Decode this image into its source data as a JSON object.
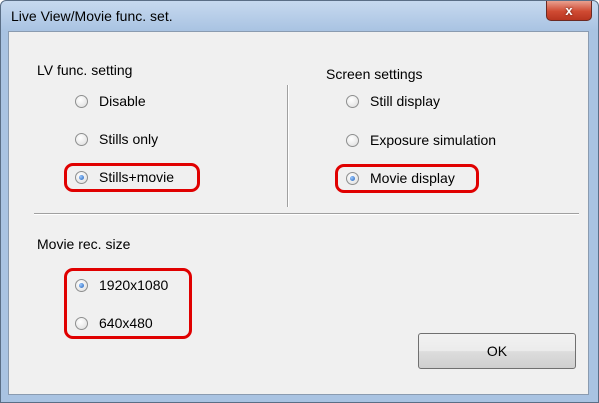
{
  "window": {
    "title": "Live View/Movie func. set.",
    "close_glyph": "x"
  },
  "lv_func": {
    "heading": "LV func. setting",
    "options": [
      {
        "label": "Disable",
        "checked": false
      },
      {
        "label": "Stills only",
        "checked": false
      },
      {
        "label": "Stills+movie",
        "checked": true
      }
    ]
  },
  "screen_settings": {
    "heading": "Screen settings",
    "options": [
      {
        "label": "Still display",
        "checked": false
      },
      {
        "label": "Exposure simulation",
        "checked": false
      },
      {
        "label": "Movie display",
        "checked": true
      }
    ]
  },
  "movie_rec_size": {
    "heading": "Movie rec. size",
    "options": [
      {
        "label": "1920x1080",
        "checked": true
      },
      {
        "label": "640x480",
        "checked": false
      }
    ]
  },
  "ok_label": "OK",
  "colors": {
    "highlight": "#e00000",
    "radio_dot": "#1f5fb8",
    "dialog_bg": "#f0f0f0"
  }
}
